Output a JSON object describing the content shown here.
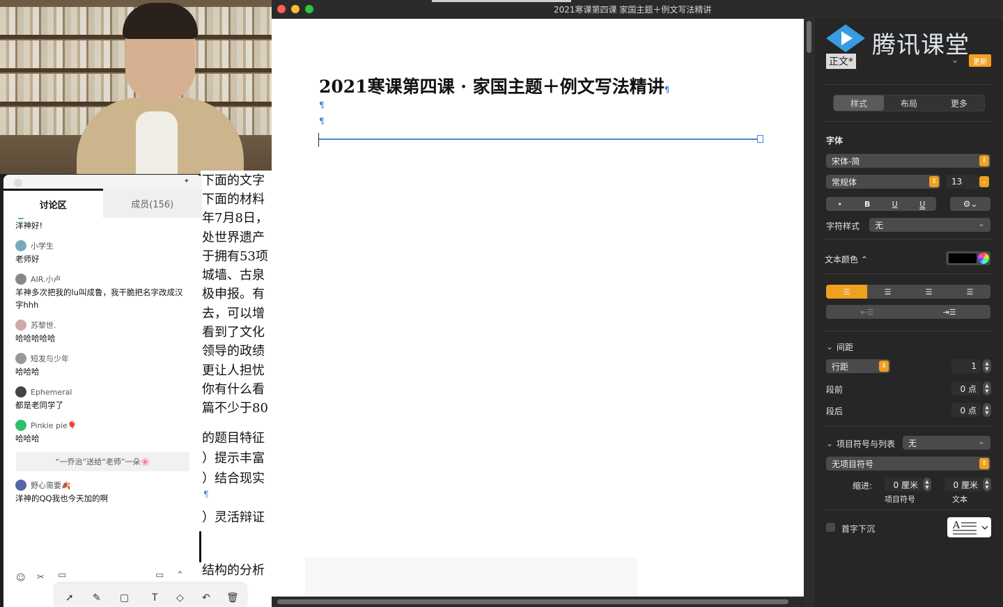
{
  "window": {
    "title": "2021寒课第四课   家国主题＋例文写法精讲"
  },
  "chat": {
    "tabs": [
      {
        "label": "讨论区"
      },
      {
        "label": "成员(156)"
      }
    ],
    "messages": [
      {
        "user": "",
        "text": "洋神好!",
        "avatar_color": "#2ec06a"
      },
      {
        "user": "小学生",
        "text": "老师好",
        "avatar_color": "#7ab"
      },
      {
        "user": "AIR.小卢",
        "text": "羊神多次把我的lu叫成鲁，我干脆把名字改成汉字hhh",
        "avatar_color": "#888"
      },
      {
        "user": "苏黎世.",
        "text": "哈哈哈哈哈",
        "avatar_color": "#caa"
      },
      {
        "user": "短发与少年",
        "text": "哈哈哈",
        "avatar_color": "#999"
      },
      {
        "user": "Ephemeral",
        "text": "都是老同学了",
        "avatar_color": "#444"
      },
      {
        "user": "Pinkie pie🎈",
        "text": "哈哈哈",
        "avatar_color": "#2ec06a"
      }
    ],
    "gift_notice": "“一乔治”送给“老师”一朵🌸",
    "last_message": {
      "user": "野心需要🍂",
      "text": "洋神的QQ我也今天加的啊",
      "avatar_color": "#5567aa"
    }
  },
  "doc_sliver": {
    "lines": [
      "下面的文字",
      "下面的材料",
      "年7月8日，",
      "处世界遗产",
      "于拥有53项",
      "城墙、古泉",
      "极申报。有",
      "去，可以增",
      "看到了文化",
      "领导的政绩",
      "更让人担忧",
      "你有什么看",
      "篇不少于80",
      "的题目特征",
      "）提示丰富",
      "）结合现实",
      "¶",
      "）灵活辩证",
      "结构的分析"
    ]
  },
  "document": {
    "heading": "2021寒课第四课 · 家国主题＋例文写法精讲",
    "pilcrow": "¶"
  },
  "brand": {
    "name": "腾讯课堂"
  },
  "inspector": {
    "paragraph_style": "正文*",
    "update_label": "更新",
    "tabs": [
      {
        "label": "样式",
        "active": true
      },
      {
        "label": "布局",
        "active": false
      },
      {
        "label": "更多",
        "active": false
      }
    ],
    "font_section": "字体",
    "font_family": "宋体-简",
    "font_weight": "常规体",
    "font_size": "13",
    "format_buttons": [
      "•",
      "B",
      "U",
      "U"
    ],
    "char_style_label": "字符样式",
    "char_style_value": "无",
    "text_color_label": "文本颜色 ⌃",
    "text_color": "#000000",
    "spacing_section": "间距",
    "line_spacing_label": "行距",
    "line_spacing_value": "1",
    "before_label": "段前",
    "before_value": "0 点",
    "after_label": "段后",
    "after_value": "0 点",
    "bullets_label": "项目符号与列表",
    "bullets_value": "无",
    "bullet_type": "无项目符号",
    "indent_label": "缩进:",
    "bullet_indent_value": "0 厘米",
    "bullet_indent_caption": "项目符号",
    "text_indent_value": "0 厘米",
    "text_indent_caption": "文本",
    "dropcap_label": "首字下沉",
    "accent_color": "#f0a020"
  }
}
